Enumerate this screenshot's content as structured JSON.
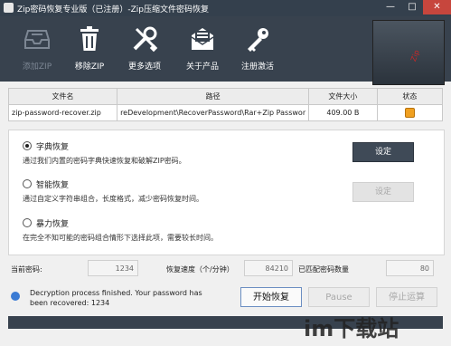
{
  "window": {
    "title": "Zip密码恢复专业版（已注册）-Zip压缩文件密码恢复",
    "minimize_glyph": "—",
    "maximize_glyph": "□",
    "close_glyph": "✕"
  },
  "toolbar": {
    "items": [
      {
        "label": "添加ZIP",
        "icon": "inbox-icon",
        "enabled": false
      },
      {
        "label": "移除ZIP",
        "icon": "trash-icon",
        "enabled": true
      },
      {
        "label": "更多选项",
        "icon": "tools-icon",
        "enabled": true
      },
      {
        "label": "关于产品",
        "icon": "envelope-icon",
        "enabled": true
      },
      {
        "label": "注册激活",
        "icon": "key-icon",
        "enabled": true
      }
    ],
    "product_box_text": "Zip"
  },
  "file_table": {
    "headers": [
      "文件名",
      "路径",
      "文件大小",
      "状态"
    ],
    "rows": [
      {
        "name": "zip-password-recover.zip",
        "path": "reDevelopment\\RecoverPassword\\Rar+Zip Passwor",
        "size": "409.00 B",
        "status_icon": "lock-icon"
      }
    ]
  },
  "modes": [
    {
      "name": "字典恢复",
      "desc": "通过我们内置的密码字典快速恢复和破解ZIP密码。",
      "checked": true,
      "button": "设定"
    },
    {
      "name": "智能恢复",
      "desc": "通过自定义字符串组合，长度格式，减少密码恢复时间。",
      "checked": false,
      "button": "设定"
    },
    {
      "name": "暴力恢复",
      "desc": "在完全不知可能的密码组合情形下选择此项，需要较长时间。",
      "checked": false
    }
  ],
  "stats": {
    "current_password_label": "当前密码:",
    "current_password_value": "1234",
    "speed_label": "恢复速度（个/分钟）",
    "speed_value": "84210",
    "matched_label": "已匹配密码数量",
    "matched_value": "80"
  },
  "status": {
    "message": "Decryption process finished. Your password has been recovered: 1234"
  },
  "actions": {
    "start": "开始恢复",
    "pause": "Pause",
    "stop": "停止运算"
  },
  "watermark": "im下载站"
}
